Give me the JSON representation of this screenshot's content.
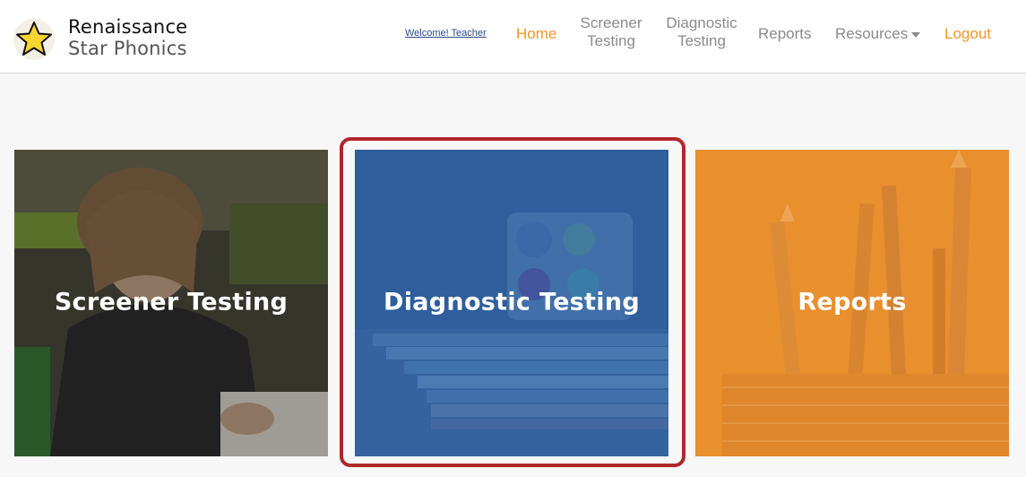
{
  "header": {
    "logo_line1": "Renaissance",
    "logo_line2": "Star Phonics",
    "welcome": "Welcome! Teacher",
    "nav": {
      "home": "Home",
      "screener_line1": "Screener",
      "screener_line2": "Testing",
      "diagnostic_line1": "Diagnostic",
      "diagnostic_line2": "Testing",
      "reports": "Reports",
      "resources": "Resources",
      "logout": "Logout"
    }
  },
  "cards": [
    {
      "title": "Screener Testing",
      "overlay": "#3a3a3a"
    },
    {
      "title": "Diagnostic Testing",
      "overlay": "#2f5f9e"
    },
    {
      "title": "Reports",
      "overlay": "#e8902e"
    }
  ],
  "colors": {
    "accent_orange": "#f0962c",
    "nav_gray": "#8a8a8a",
    "highlight_red": "#b0272c",
    "star_yellow": "#f7d531"
  },
  "icons": {
    "logo": "star-icon",
    "resources_dropdown": "caret-down-icon"
  }
}
